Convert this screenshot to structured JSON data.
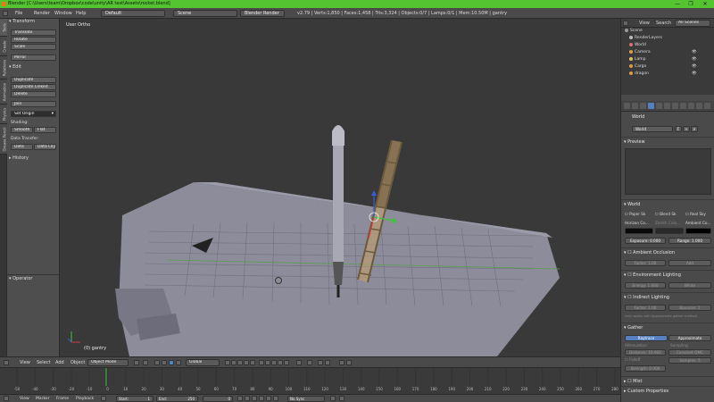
{
  "window": {
    "title": "Blender [C:\\Users\\team\\Dropbox\\code\\unity\\AR test\\Assets\\rocket.blend]",
    "controls": [
      "—",
      "❐",
      "✕"
    ]
  },
  "infobar": {
    "menus": [
      "File",
      "Render",
      "Window",
      "Help"
    ],
    "layout": "Default",
    "scene": "Scene",
    "engine": "Blender Render",
    "stats": "v2.79 | Verts:1,850 | Faces:1,458 | Tris:3,324 | Objects:0/7 | Lamps:0/1 | Mem:10.50M | gantry"
  },
  "left_tabs": [
    "Tools",
    "Create",
    "Relations",
    "Animation",
    "Physics",
    "Grease Pencil"
  ],
  "toolshelf": {
    "transform_header": "Transform",
    "transform_buttons": [
      "Translate",
      "Rotate",
      "Scale",
      "Mirror"
    ],
    "edit_header": "Edit",
    "edit_buttons": [
      "Duplicate",
      "Duplicate Linked",
      "Delete",
      "Join"
    ],
    "set_origin": "Set Origin",
    "shading_label": "Shading:",
    "smooth": "Smooth",
    "flat": "Flat",
    "data_transfer_label": "Data Transfer:",
    "data": "Data",
    "data_layout": "Data Layout",
    "history_header": "History",
    "operator_header": "Operator"
  },
  "viewport": {
    "view_label": "User Ortho",
    "object_label": "(0) gantry"
  },
  "outliner": {
    "header": {
      "view": "View",
      "search": "Search",
      "scenes": "All Scenes"
    },
    "rows": [
      {
        "label": "Scene",
        "color": "#9a9a9a"
      },
      {
        "label": "RenderLayers",
        "color": "#bbbbbb"
      },
      {
        "label": "World",
        "color": "#d87070"
      },
      {
        "label": "Camera",
        "color": "#e09a4a"
      },
      {
        "label": "Lamp",
        "color": "#e0c060"
      },
      {
        "label": "Cargo",
        "color": "#e09a4a"
      },
      {
        "label": "dragon",
        "color": "#e09a4a"
      }
    ]
  },
  "properties": {
    "world_name": "World",
    "world_field": "World",
    "users_badge": "F",
    "preview_header": "Preview",
    "world_header": "World",
    "paper_sky": "Paper Sk",
    "blend_sky": "Blend Sk",
    "real_sky": "Real Sky",
    "horizon_color": "Horizon Co...",
    "zenith_color": "Zenith Colo...",
    "ambient_color": "Ambient Co...",
    "exposure": "Exposure: 0.000",
    "range": "Range: 1.000",
    "ao_header": "Ambient Occlusion",
    "factor_ao": "Factor: 1.00",
    "add": "Add",
    "env_header": "Environment Lighting",
    "energy": "Energy: 1.000",
    "white": "White",
    "indirect_header": "Indirect Lighting",
    "factor_ind": "Factor: 1.00",
    "bounces": "Bounces: 1",
    "indirect_note": "Only works with Approximate gather method",
    "gather_header": "Gather",
    "raytrace": "Raytrace",
    "approximate": "Approximate",
    "attenuation_label": "Attenuation:",
    "sampling_label": "Sampling:",
    "distance": "Distance: 10.000",
    "constant_qmc": "Constant QMC",
    "falloff": "Falloff",
    "samples": "Samples: 5",
    "strength": "Strength: 0.000",
    "mist_header": "Mist",
    "custom_header": "Custom Properties"
  },
  "vp_header": {
    "view": "View",
    "select": "Select",
    "add": "Add",
    "object": "Object",
    "mode": "Object Mode",
    "orientation": "Global"
  },
  "timeline": {
    "ticks": [
      "-50",
      "-40",
      "-30",
      "-20",
      "-10",
      "0",
      "10",
      "20",
      "30",
      "40",
      "50",
      "60",
      "70",
      "80",
      "90",
      "100",
      "110",
      "120",
      "130",
      "140",
      "150",
      "160",
      "170",
      "180",
      "190",
      "200",
      "210",
      "220",
      "230",
      "240",
      "250",
      "260",
      "270",
      "280"
    ],
    "current_frame": 0
  },
  "tl_footer": {
    "view": "View",
    "marker": "Marker",
    "frame": "Frame",
    "playback": "Playback",
    "start": "Start:",
    "start_val": "1",
    "end": "End:",
    "end_val": "250",
    "current": "0",
    "sync": "No Sync"
  }
}
